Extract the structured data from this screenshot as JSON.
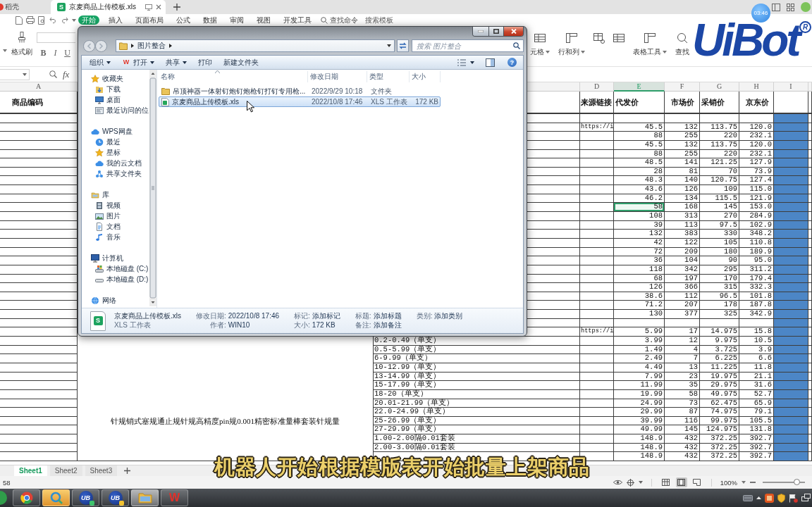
{
  "browser_tabs": [
    {
      "label": "稻壳",
      "selected": false
    },
    {
      "label": "京麦商品上传模板.xls",
      "icon_letter": "S",
      "selected": true
    }
  ],
  "menu_tabs": [
    {
      "label": "开始",
      "selected": true
    },
    {
      "label": "插入",
      "selected": false
    },
    {
      "label": "页面布局",
      "selected": false
    },
    {
      "label": "公式",
      "selected": false
    },
    {
      "label": "数据",
      "selected": false
    },
    {
      "label": "审阅",
      "selected": false
    },
    {
      "label": "视图",
      "selected": false
    },
    {
      "label": "开发工具",
      "selected": false
    }
  ],
  "command_search": "查找命令",
  "template_search": "搜索模板",
  "ribbon": {
    "format_painter": "格式刷",
    "text_styles": [
      "B",
      "I",
      "U"
    ],
    "tools": [
      {
        "kind": "labeled",
        "label": "元格",
        "menu": true
      },
      {
        "kind": "labeled",
        "label": "行和列",
        "menu": true
      },
      {
        "kind": "icon"
      },
      {
        "kind": "icon"
      },
      {
        "kind": "labeled",
        "label": "表格工具",
        "menu": true
      },
      {
        "kind": "labeled",
        "label": "查找",
        "menu": false
      }
    ]
  },
  "formula_bar": {
    "fx": "fx"
  },
  "sheet": {
    "columns": [
      {
        "letter": "A",
        "heading": "商品编码",
        "selected": false,
        "filled": false
      },
      {
        "filled": false
      },
      {
        "selected": false,
        "filled": false
      },
      {
        "letter": "D",
        "heading": "来源链接",
        "selected": false,
        "filled": false
      },
      {
        "letter": "E",
        "heading": "代发价",
        "selected": true,
        "filled": false
      },
      {
        "letter": "F",
        "heading": "市场价",
        "selected": false,
        "filled": false
      },
      {
        "letter": "G",
        "heading": "采销价",
        "selected": false,
        "filled": false
      },
      {
        "letter": "H",
        "heading": "京东价",
        "selected": false,
        "filled": false
      },
      {
        "letter": "I",
        "selected": false,
        "filled": true
      }
    ],
    "rows": [
      {
        "selected": false
      },
      {
        "selected": false,
        "source_link": "https://i",
        "dropship_price": "45.5",
        "market_price": "132",
        "purchase_price": "113.75",
        "jd_price": "120.0"
      },
      {
        "selected": false,
        "dropship_price": "88",
        "market_price": "255",
        "purchase_price": "220",
        "jd_price": "232.1"
      },
      {
        "selected": false,
        "dropship_price": "45.5",
        "market_price": "132",
        "purchase_price": "113.75",
        "jd_price": "120.0"
      },
      {
        "selected": false,
        "dropship_price": "88",
        "market_price": "255",
        "purchase_price": "220",
        "jd_price": "232.1"
      },
      {
        "selected": false,
        "dropship_price": "48.5",
        "market_price": "141",
        "purchase_price": "121.25",
        "jd_price": "127.9"
      },
      {
        "selected": false,
        "dropship_price": "28",
        "market_price": "81",
        "purchase_price": "70",
        "jd_price": "73.9"
      },
      {
        "selected": false,
        "dropship_price": "48.3",
        "market_price": "140",
        "purchase_price": "120.75",
        "jd_price": "127.4"
      },
      {
        "selected": false,
        "dropship_price": "43.6",
        "market_price": "126",
        "purchase_price": "109",
        "jd_price": "115.0"
      },
      {
        "selected": false,
        "dropship_price": "46.2",
        "market_price": "134",
        "purchase_price": "115.5",
        "jd_price": "121.9"
      },
      {
        "selected": true,
        "dropship_price": "58",
        "market_price": "168",
        "purchase_price": "145",
        "jd_price": "153.0"
      },
      {
        "selected": false,
        "dropship_price": "108",
        "market_price": "313",
        "purchase_price": "270",
        "jd_price": "284.9"
      },
      {
        "selected": false,
        "dropship_price": "39",
        "market_price": "113",
        "purchase_price": "97.5",
        "jd_price": "102.9"
      },
      {
        "selected": false,
        "dropship_price": "132",
        "market_price": "383",
        "purchase_price": "330",
        "jd_price": "348.2"
      },
      {
        "selected": false,
        "dropship_price": "42",
        "market_price": "122",
        "purchase_price": "105",
        "jd_price": "110.8"
      },
      {
        "selected": false,
        "dropship_price": "72",
        "market_price": "209",
        "purchase_price": "180",
        "jd_price": "189.9"
      },
      {
        "selected": false,
        "dropship_price": "36",
        "market_price": "104",
        "purchase_price": "90",
        "jd_price": "95.0"
      },
      {
        "selected": false,
        "dropship_price": "118",
        "market_price": "342",
        "purchase_price": "295",
        "jd_price": "311.2"
      },
      {
        "selected": false,
        "dropship_price": "68",
        "market_price": "197",
        "purchase_price": "170",
        "jd_price": "179.4"
      },
      {
        "selected": false,
        "dropship_price": "126",
        "market_price": "366",
        "purchase_price": "315",
        "jd_price": "332.3"
      },
      {
        "selected": false,
        "dropship_price": "38.6",
        "market_price": "112",
        "purchase_price": "96.5",
        "jd_price": "101.8"
      },
      {
        "selected": false,
        "dropship_price": "71.2",
        "market_price": "207",
        "purchase_price": "178",
        "jd_price": "187.8"
      },
      {
        "selected": false,
        "dropship_price": "130",
        "market_price": "377",
        "purchase_price": "325",
        "jd_price": "342.9"
      },
      {
        "selected": false
      },
      {
        "selected": false,
        "column_b": "针规销式塞规通止规针规高精度pin规0.001精密标准量棒套装针规量",
        "source_link": "https://i",
        "dropship_price": "5.99",
        "market_price": "17",
        "purchase_price": "14.975",
        "jd_price": "15.8"
      },
      {
        "selected": false,
        "column_c": "0.2-0.49（单支）",
        "dropship_price": "3.99",
        "market_price": "12",
        "purchase_price": "9.975",
        "jd_price": "10.5"
      },
      {
        "selected": false,
        "column_c": "0.5-5.99（单支）",
        "dropship_price": "1.49",
        "market_price": "4",
        "purchase_price": "3.725",
        "jd_price": "3.9"
      },
      {
        "selected": false,
        "column_c": "6-9.99（单支）",
        "dropship_price": "2.49",
        "market_price": "7",
        "purchase_price": "6.225",
        "jd_price": "6.6"
      },
      {
        "selected": false,
        "column_c": "10-12.99（单支）",
        "dropship_price": "4.49",
        "market_price": "13",
        "purchase_price": "11.225",
        "jd_price": "11.8"
      },
      {
        "selected": false,
        "column_c": "13-14.99（单支）",
        "dropship_price": "7.99",
        "market_price": "23",
        "purchase_price": "19.975",
        "jd_price": "21.1"
      },
      {
        "selected": false,
        "column_c": "15-17.99（单支）",
        "dropship_price": "11.99",
        "market_price": "35",
        "purchase_price": "29.975",
        "jd_price": "31.6"
      },
      {
        "selected": false,
        "column_c": "18-20（单支）",
        "dropship_price": "19.99",
        "market_price": "58",
        "purchase_price": "49.975",
        "jd_price": "52.7"
      },
      {
        "selected": false,
        "column_c": "20.01-21.99（单支）",
        "dropship_price": "24.99",
        "market_price": "73",
        "purchase_price": "62.475",
        "jd_price": "65.9"
      },
      {
        "selected": false,
        "column_c": "22.0-24.99（单支）",
        "dropship_price": "29.99",
        "market_price": "87",
        "purchase_price": "74.975",
        "jd_price": "79.1"
      },
      {
        "selected": false,
        "column_c": "25-26.99（单支）",
        "dropship_price": "39.99",
        "market_price": "116",
        "purchase_price": "99.975",
        "jd_price": "105.5"
      },
      {
        "selected": false,
        "column_c": "27-29.99（单支）",
        "dropship_price": "49.99",
        "market_price": "145",
        "purchase_price": "124.975",
        "jd_price": "131.8"
      },
      {
        "selected": false,
        "column_c": "1.00-2.00隔0.01套装",
        "dropship_price": "148.9",
        "market_price": "432",
        "purchase_price": "372.25",
        "jd_price": "392.7"
      },
      {
        "selected": false,
        "column_c": "2.00-3.00隔0.01套装",
        "dropship_price": "148.9",
        "market_price": "432",
        "purchase_price": "372.25",
        "jd_price": "392.7"
      },
      {
        "selected": false,
        "dropship_price": "148.9",
        "market_price": "432",
        "purchase_price": "372.25",
        "jd_price": "392.7"
      }
    ]
  },
  "sheet_tabs": [
    {
      "label": "Sheet1",
      "selected": true
    },
    {
      "label": "Sheet2",
      "selected": false
    },
    {
      "label": "Sheet3",
      "selected": false
    }
  ],
  "status_bar": {
    "text": "58",
    "views": [
      {
        "kind": "normal",
        "selected": false
      },
      {
        "kind": "page_layout",
        "selected": true
      },
      {
        "kind": "page_break",
        "selected": false
      }
    ],
    "zoom": "100%",
    "zoom_slider": {
      "level": 0.8
    }
  },
  "taskbar": [
    {
      "kind": "browser",
      "active": false
    },
    {
      "kind": "ring",
      "active": false
    },
    {
      "kind": "uibot",
      "label": "UB",
      "active": false
    },
    {
      "kind": "uibot_worker",
      "label": "UB",
      "active": false
    },
    {
      "kind": "folder",
      "active": true
    },
    {
      "kind": "wps",
      "label": "W",
      "active": false
    }
  ],
  "explorer": {
    "address": [
      "图片整合"
    ],
    "search_placeholder": "搜索 图片整合",
    "toolbar": [
      {
        "label": "组织",
        "menu": true
      },
      {
        "label": "打开",
        "icon_letter": "W",
        "menu": true
      },
      {
        "label": "共享",
        "menu": true
      },
      {
        "label": "打印",
        "menu": false
      },
      {
        "label": "新建文件夹",
        "menu": false
      }
    ],
    "help": "?",
    "nav": [
      {
        "kind": "favorites",
        "label": "收藏夹",
        "children": [
          {
            "kind": "downloads",
            "label": "下载"
          },
          {
            "kind": "desktop",
            "label": "桌面"
          },
          {
            "kind": "recent_places",
            "label": "最近访问的位"
          }
        ]
      },
      {
        "kind": "cloud_drive",
        "label": "WPS网盘",
        "children": [
          {
            "kind": "recent",
            "label": "最近"
          },
          {
            "kind": "starred",
            "label": "星标"
          },
          {
            "kind": "cloud_docs",
            "label": "我的云文档"
          },
          {
            "kind": "shared_folder",
            "label": "共享文件夹"
          }
        ]
      },
      {
        "kind": "libraries",
        "label": "库",
        "children": [
          {
            "kind": "videos",
            "label": "视频"
          },
          {
            "kind": "pictures",
            "label": "图片"
          },
          {
            "kind": "documents",
            "label": "文档"
          },
          {
            "kind": "music",
            "label": "音乐"
          }
        ]
      },
      {
        "kind": "computer",
        "label": "计算机",
        "children": [
          {
            "kind": "system_drive",
            "label": "本地磁盘 (C:)"
          },
          {
            "kind": "drive",
            "label": "本地磁盘 (D:)"
          }
        ]
      },
      {
        "kind": "network",
        "label": "网络"
      }
    ],
    "columns": [
      "名称",
      "修改日期",
      "类型",
      "大小"
    ],
    "files": [
      {
        "kind": "folder",
        "name": "吊顶神器一体射钉炮钉炮枪钉打钉专用枪...",
        "modified": "2022/9/29 10:18",
        "type": "文件夹",
        "selected": false
      },
      {
        "kind": "spreadsheet",
        "name": "京麦商品上传模板.xls",
        "modified": "2022/10/8 17:46",
        "type": "XLS 工作表",
        "size": "172 KB",
        "selected": true
      }
    ],
    "details": {
      "icon_letter": "S",
      "name": "京麦商品上传模板.xls",
      "type": "XLS 工作表",
      "fields": [
        {
          "label": "修改日期:",
          "value": "2022/10/8 17:46"
        },
        {
          "label": "作者:",
          "value": "WIN10"
        },
        {
          "label": "标记:",
          "value": "添加标记"
        },
        {
          "label": "大小:",
          "value": "172 KB"
        },
        {
          "label": "标题:",
          "value": "添加标题"
        },
        {
          "label": "备注:",
          "value": "添加备注"
        },
        {
          "label": "类别:",
          "value": "添加类别"
        }
      ]
    }
  },
  "logo": {
    "text": "UiBot",
    "timer": "03:46",
    "mark": "R"
  },
  "subtitle": "机器人开始根据模版表开始批量上架商品"
}
